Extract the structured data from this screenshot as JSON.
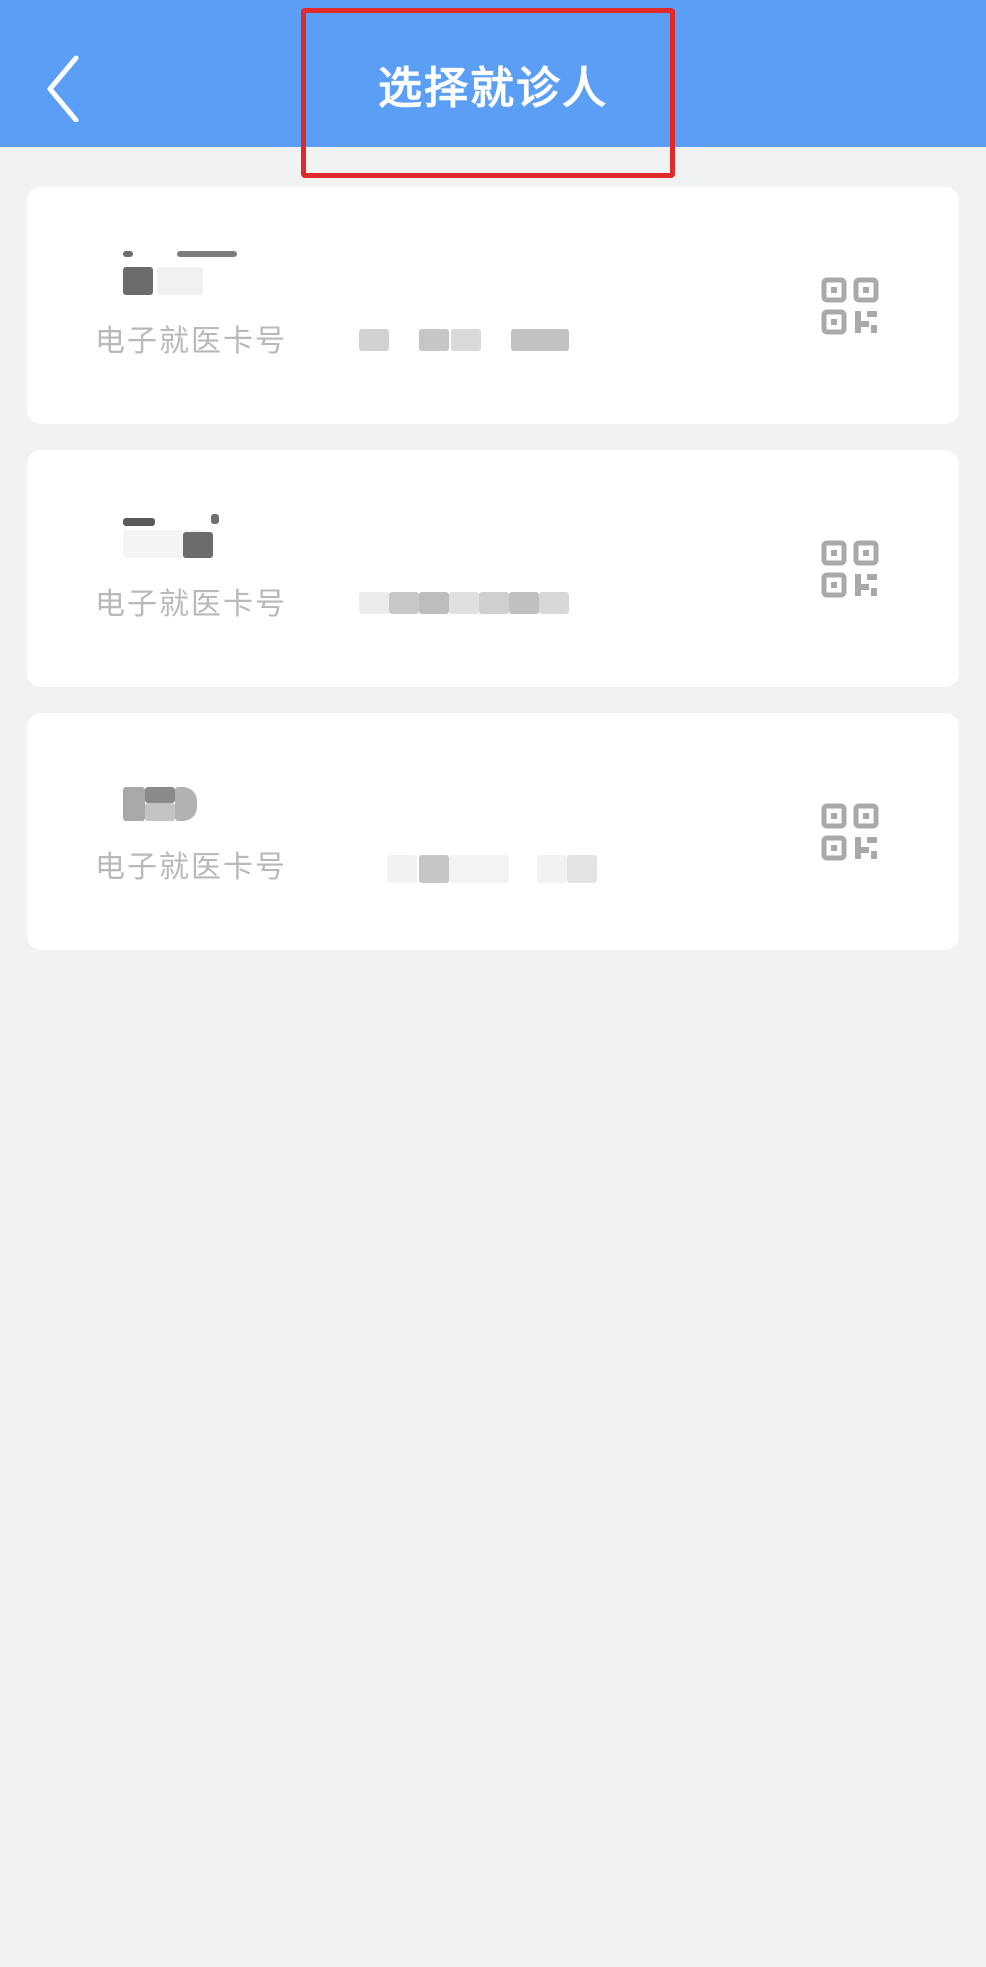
{
  "header": {
    "title": "选择就诊人",
    "back_icon": "chevron-left-icon",
    "background_color": "#5b9ef5",
    "highlight_color": "#e02a2a"
  },
  "patients": [
    {
      "card_label": "电子就医卡号",
      "qr_icon": "qr-code-icon"
    },
    {
      "card_label": "电子就医卡号",
      "qr_icon": "qr-code-icon"
    },
    {
      "card_label": "电子就医卡号",
      "qr_icon": "qr-code-icon"
    }
  ],
  "colors": {
    "page_background": "#f1f2f2",
    "card_background": "#ffffff",
    "label_text": "#b9b9b9",
    "icon_color": "#a9a9a9"
  }
}
